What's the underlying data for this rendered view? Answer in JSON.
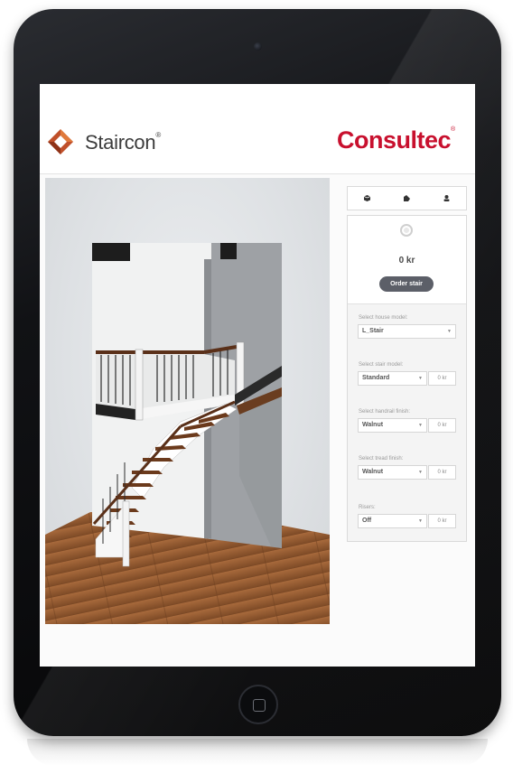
{
  "header": {
    "left_logo": "Staircon",
    "right_logo": "Consultec",
    "registered": "®"
  },
  "toolbar": {
    "icons": [
      "box-icon",
      "swatch-icon",
      "user-icon"
    ]
  },
  "summary": {
    "price": "0 kr",
    "order_label": "Order stair"
  },
  "options": {
    "house_model": {
      "label": "Select house model:",
      "value": "L_Stair"
    },
    "stair_model": {
      "label": "Select stair model:",
      "value": "Standard",
      "price": "0 kr"
    },
    "handrail_finish": {
      "label": "Select handrail finish:",
      "value": "Walnut",
      "price": "0 kr"
    },
    "tread_finish": {
      "label": "Select tread finish:",
      "value": "Walnut",
      "price": "0 kr"
    },
    "risers": {
      "label": "Risers:",
      "value": "Off",
      "price": "0 kr"
    }
  },
  "caret": "▼"
}
